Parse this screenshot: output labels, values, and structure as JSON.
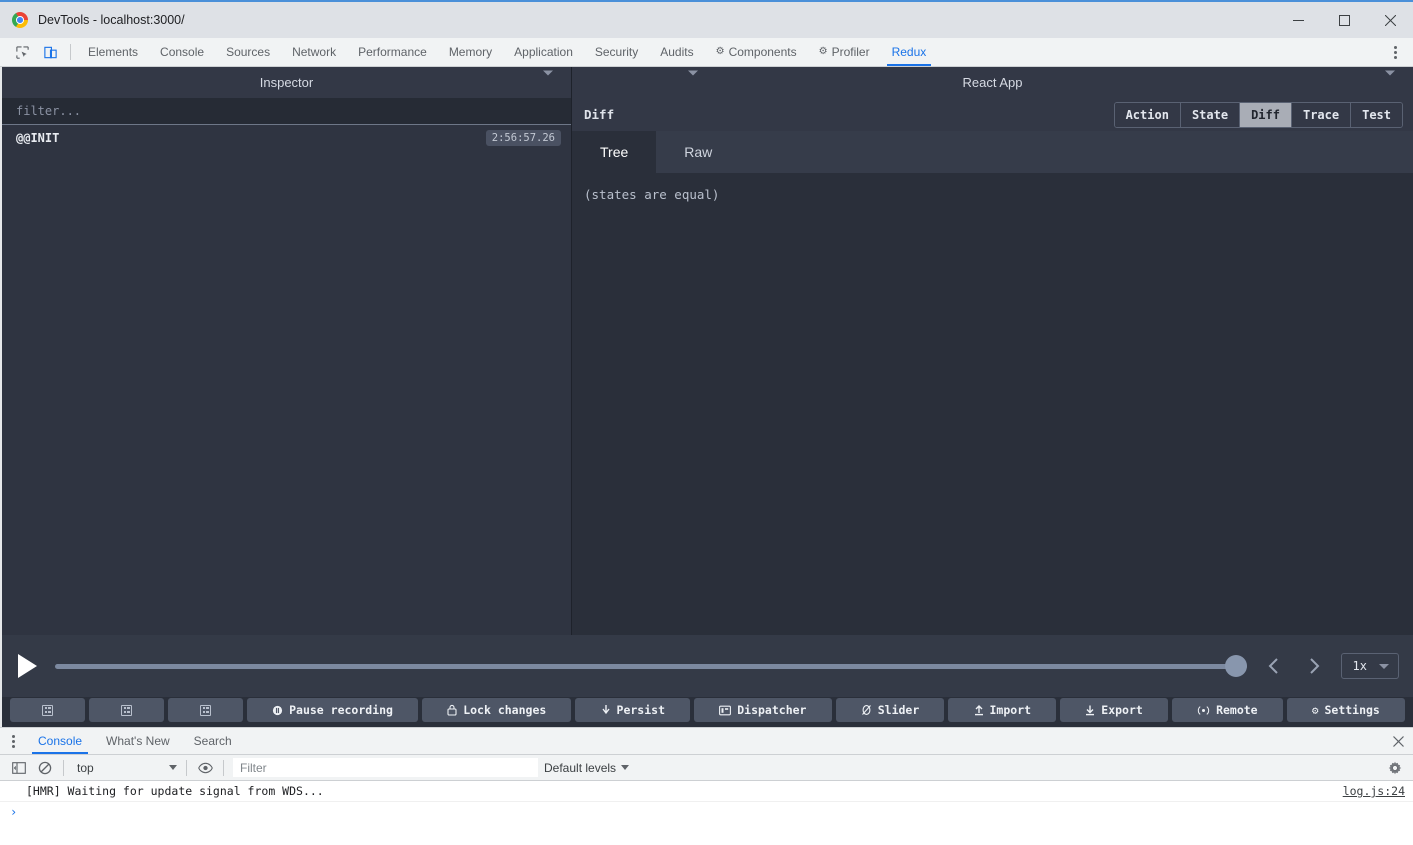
{
  "window": {
    "title": "DevTools - localhost:3000/",
    "logo_icon": "chrome-logo-icon",
    "minimize_icon": "minimize-icon",
    "maximize_icon": "maximize-icon",
    "close_icon": "close-icon",
    "accent": "#1a73e8"
  },
  "devtools_tabbar": {
    "inspect_icon": "inspect-element-icon",
    "device_icon": "device-toolbar-icon",
    "menu_icon": "more-options-icon",
    "tabs": [
      {
        "label": "Elements",
        "active": false,
        "gear": false
      },
      {
        "label": "Console",
        "active": false,
        "gear": false
      },
      {
        "label": "Sources",
        "active": false,
        "gear": false
      },
      {
        "label": "Network",
        "active": false,
        "gear": false
      },
      {
        "label": "Performance",
        "active": false,
        "gear": false
      },
      {
        "label": "Memory",
        "active": false,
        "gear": false
      },
      {
        "label": "Application",
        "active": false,
        "gear": false
      },
      {
        "label": "Security",
        "active": false,
        "gear": false
      },
      {
        "label": "Audits",
        "active": false,
        "gear": false
      },
      {
        "label": "Components",
        "active": false,
        "gear": true
      },
      {
        "label": "Profiler",
        "active": false,
        "gear": true
      },
      {
        "label": "Redux",
        "active": true,
        "gear": false
      }
    ]
  },
  "inspector": {
    "header_title": "Inspector",
    "header_caret_icon": "chevron-down-icon",
    "filter_placeholder": "filter...",
    "actions": [
      {
        "name": "@@INIT",
        "timestamp": "2:56:57.26"
      }
    ]
  },
  "monitor": {
    "header_title": "React App",
    "header_caret_left_icon": "chevron-down-icon",
    "header_caret_right_icon": "chevron-down-icon",
    "selected_tab_label": "Diff",
    "tabs": [
      {
        "label": "Action",
        "active": false
      },
      {
        "label": "State",
        "active": false
      },
      {
        "label": "Diff",
        "active": true
      },
      {
        "label": "Trace",
        "active": false
      },
      {
        "label": "Test",
        "active": false
      }
    ],
    "subtabs": [
      {
        "label": "Tree",
        "active": true
      },
      {
        "label": "Raw",
        "active": false
      }
    ],
    "diff_body_text": "(states are equal)"
  },
  "player": {
    "play_icon": "play-icon",
    "slider_value": 100,
    "prev_icon": "chevron-left-icon",
    "next_icon": "chevron-right-icon",
    "speed_label": "1x",
    "speed_caret_icon": "chevron-down-icon"
  },
  "toolbar": {
    "buttons": [
      {
        "label": "",
        "icon": "layout-grid-icon",
        "icon_only": true
      },
      {
        "label": "",
        "icon": "layout-grid-icon",
        "icon_only": true
      },
      {
        "label": "",
        "icon": "layout-grid-icon",
        "icon_only": true
      },
      {
        "label": "Pause recording",
        "icon": "pause-recording-icon",
        "icon_only": false
      },
      {
        "label": "Lock changes",
        "icon": "lock-icon",
        "icon_only": false
      },
      {
        "label": "Persist",
        "icon": "pin-icon",
        "icon_only": false
      },
      {
        "label": "Dispatcher",
        "icon": "dispatcher-icon",
        "icon_only": false
      },
      {
        "label": "Slider",
        "icon": "slider-icon",
        "icon_only": false
      },
      {
        "label": "Import",
        "icon": "import-icon",
        "icon_only": false
      },
      {
        "label": "Export",
        "icon": "export-icon",
        "icon_only": false
      },
      {
        "label": "Remote",
        "icon": "remote-icon",
        "icon_only": false
      },
      {
        "label": "Settings",
        "icon": "gear-icon",
        "icon_only": false
      }
    ]
  },
  "drawer": {
    "menu_icon": "drawer-menu-icon",
    "close_icon": "close-icon",
    "tabs": [
      {
        "label": "Console",
        "active": true
      },
      {
        "label": "What's New",
        "active": false
      },
      {
        "label": "Search",
        "active": false
      }
    ],
    "console_toolbar": {
      "sidebar_icon": "console-sidebar-icon",
      "clear_icon": "clear-console-icon",
      "context_value": "top",
      "context_caret_icon": "chevron-down-icon",
      "eye_icon": "live-expression-icon",
      "filter_placeholder": "Filter",
      "levels_label": "Default levels",
      "levels_caret_icon": "chevron-down-icon",
      "settings_icon": "gear-icon"
    },
    "messages": [
      {
        "text": "[HMR] Waiting for update signal from WDS...",
        "source": "log.js:24"
      }
    ],
    "prompt_caret": "›"
  }
}
